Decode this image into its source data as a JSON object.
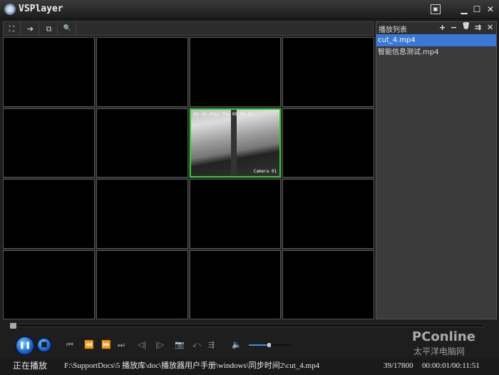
{
  "window": {
    "title": "VSPlayer",
    "menu_icon": "▣",
    "minimize": "▁",
    "maximize": "☐",
    "close": "✕"
  },
  "toolbar": {
    "fullscreen": "⛶",
    "pin": "➔",
    "screen_settings": "⧉",
    "zoom": "🔍"
  },
  "grid": {
    "rows": 4,
    "cols": 4,
    "active_cell": 6,
    "osd_time": "01-18-2012 Thu 09:00:21",
    "osd_camera": "Camera 01",
    "active_color": "#33cc33"
  },
  "playlist": {
    "title": "播放列表",
    "add": "+",
    "remove": "−",
    "delete": "🗑",
    "mode": "⇉",
    "close": "✕",
    "items": [
      {
        "label": "cut_4.mp4",
        "selected": true
      },
      {
        "label": "智能信息测试.mp4",
        "selected": false
      }
    ]
  },
  "controls": {
    "progress_percent": 0.2,
    "volume_percent": 48,
    "pause": "❚❚",
    "stop": "■",
    "buttons": [
      "⏮",
      "⏪",
      "⏩",
      "⏭",
      "◁|",
      "|▷",
      "📷",
      "⤺",
      "⇶",
      "🔈"
    ]
  },
  "status": {
    "state": "正在播放",
    "path": "F:\\SupportDocs\\5 播放库\\doc\\播放器用户手册\\windows\\同步时间2\\cut_4.mp4",
    "frames": "39/17800",
    "time": "00:00:01/00:11:51"
  },
  "watermark": {
    "brand": "PConline",
    "sub": "太平洋电脑网"
  }
}
